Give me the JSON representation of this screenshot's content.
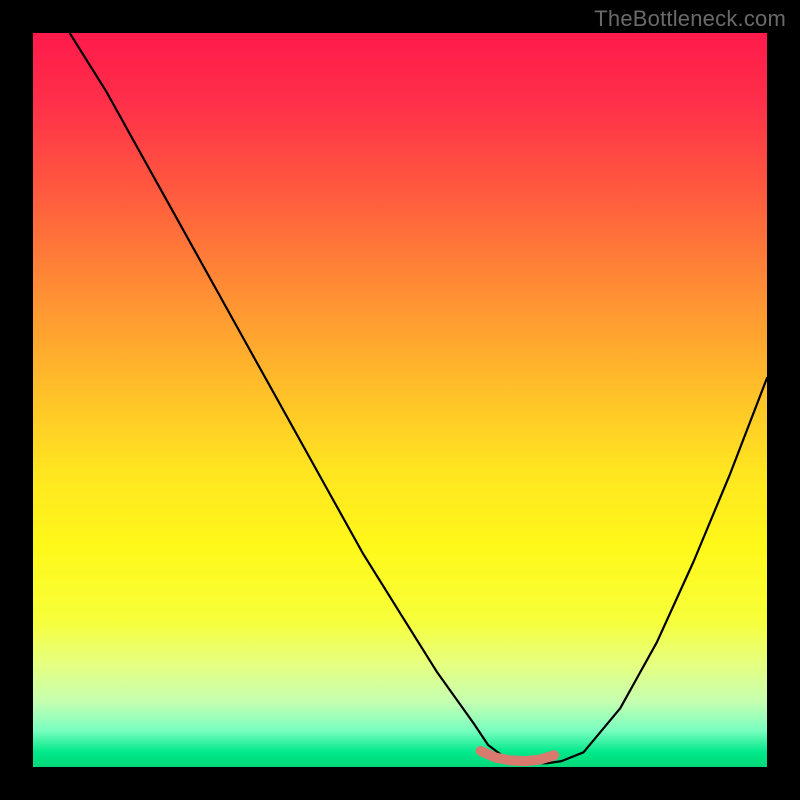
{
  "watermark": "TheBottleneck.com",
  "chart_data": {
    "type": "line",
    "title": "",
    "xlabel": "",
    "ylabel": "",
    "xlim": [
      0,
      100
    ],
    "ylim": [
      0,
      100
    ],
    "series": [
      {
        "name": "curve",
        "x": [
          5,
          10,
          15,
          20,
          25,
          30,
          35,
          40,
          45,
          50,
          55,
          60,
          62,
          64,
          66,
          68,
          70,
          72,
          75,
          80,
          85,
          90,
          95,
          100
        ],
        "y": [
          100,
          92,
          83,
          74,
          65,
          56,
          47,
          38,
          29,
          21,
          13,
          6,
          3,
          1.5,
          0.8,
          0.5,
          0.5,
          0.8,
          2,
          8,
          17,
          28,
          40,
          53
        ],
        "color": "#000000",
        "stroke_width": 2.2
      },
      {
        "name": "highlight-segment",
        "x": [
          61,
          63,
          65,
          67,
          69,
          71
        ],
        "y": [
          2.2,
          1.3,
          0.9,
          0.8,
          1.0,
          1.6
        ],
        "color": "#d97a6f",
        "stroke_width": 10
      }
    ],
    "background_gradient": {
      "top_color": "#ff1a4b",
      "mid_color": "#ffe620",
      "bottom_color": "#00d878"
    }
  }
}
